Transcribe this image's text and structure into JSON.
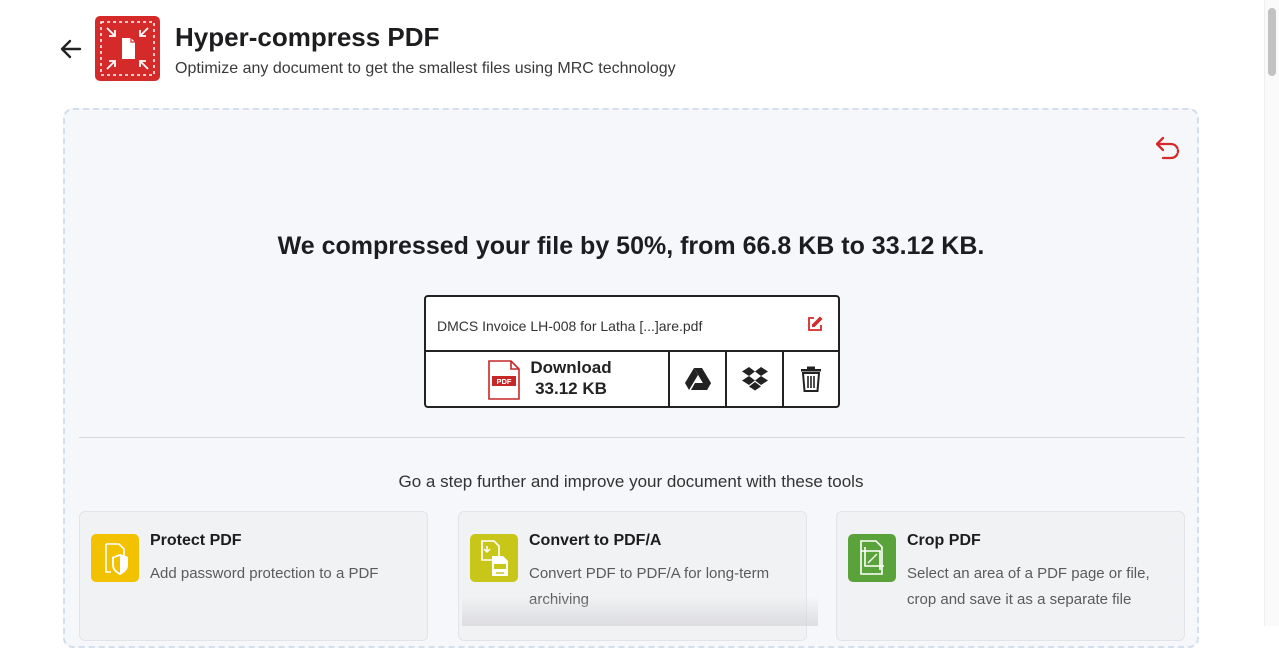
{
  "header": {
    "title": "Hyper-compress PDF",
    "subtitle": "Optimize any document to get the smallest files using MRC technology"
  },
  "result": {
    "message": "We compressed your file by 50%, from 66.8 KB to 33.12 KB.",
    "file_name": "DMCS Invoice LH-008 for Latha [...]are.pdf",
    "download_label": "Download",
    "download_size": "33.12 KB",
    "pdf_badge": "PDF"
  },
  "further": {
    "text": "Go a step further and improve your document with these tools"
  },
  "tools": [
    {
      "title": "Protect PDF",
      "desc": "Add password protection to a PDF",
      "color": "#f2c200"
    },
    {
      "title": "Convert to PDF/A",
      "desc": "Convert PDF to PDF/A for long-term archiving",
      "color": "#c9c61a"
    },
    {
      "title": "Crop PDF",
      "desc": "Select an area of a PDF page or file, crop and save it as a separate file",
      "color": "#5aa23a"
    }
  ],
  "colors": {
    "accent": "#d42a2a",
    "panel_bg": "#f5f7fa",
    "panel_border": "#d3dfec"
  },
  "icons": [
    "back-arrow-icon",
    "compress-pdf-logo-icon",
    "undo-icon",
    "edit-icon",
    "pdf-file-icon",
    "google-drive-icon",
    "dropbox-icon",
    "trash-icon",
    "shield-icon",
    "pdfa-icon",
    "crop-icon"
  ]
}
